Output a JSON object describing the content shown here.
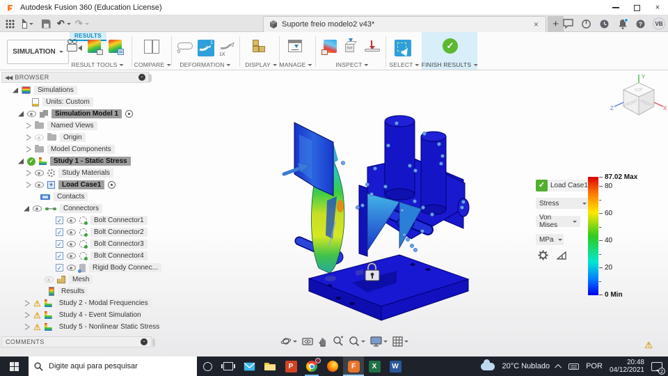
{
  "titlebar": {
    "app_title": "Autodesk Fusion 360 (Education License)"
  },
  "tabbar": {
    "document_title": "Suporte freio modelo2 v43*",
    "avatar_initials": "VB",
    "new_tab": "+",
    "close_tab": "×"
  },
  "ribbon": {
    "workspace_label": "SIMULATION",
    "active_tab": "RESULTS",
    "groups": {
      "result_tools": "RESULT TOOLS",
      "compare": "COMPARE",
      "deformation": "DEFORMATION",
      "display": "DISPLAY",
      "manage": "MANAGE",
      "inspect": "INSPECT",
      "select": "SELECT",
      "finish_results": "FINISH RESULTS"
    },
    "deformation_icon_texts": {
      "off": "0",
      "scale": "1",
      "actual": "1X"
    },
    "inspect_cube_text": "xyz"
  },
  "browser": {
    "panel_title": "BROWSER",
    "items": [
      {
        "label": "Simulations"
      },
      {
        "label": "Units: Custom"
      },
      {
        "label": "Simulation Model 1"
      },
      {
        "label": "Named Views"
      },
      {
        "label": "Origin"
      },
      {
        "label": "Model Components"
      },
      {
        "label": "Study 1 - Static Stress"
      },
      {
        "label": "Study Materials"
      },
      {
        "label": "Load Case1"
      },
      {
        "label": "Contacts"
      },
      {
        "label": "Connectors"
      },
      {
        "label": "Bolt Connector1"
      },
      {
        "label": "Bolt Connector2"
      },
      {
        "label": "Bolt Connector3"
      },
      {
        "label": "Bolt Connector4"
      },
      {
        "label": "Rigid Body Connec..."
      },
      {
        "label": "Mesh"
      },
      {
        "label": "Results"
      },
      {
        "label": "Study 2 - Modal Frequencies"
      },
      {
        "label": "Study 4 - Event Simulation"
      },
      {
        "label": "Study 5 - Nonlinear Static Stress"
      }
    ]
  },
  "legend": {
    "load_case": "Load Case1",
    "result_type": "Stress",
    "component": "Von Mises",
    "unit": "MPa",
    "scale": {
      "max_label": "87.02 Max",
      "ticks": [
        "80",
        "60",
        "40",
        "20"
      ],
      "min_label": "0 Min"
    }
  },
  "viewcube": {
    "top": "TOP",
    "front": "FRONT",
    "right": "RIGHT",
    "axis_x": "X",
    "axis_y": "Y",
    "axis_z": "Z"
  },
  "comments": {
    "panel_title": "COMMENTS"
  },
  "taskbar": {
    "search_placeholder": "Digite aqui para pesquisar",
    "weather": "20°C Nublado",
    "language": "POR",
    "time": "20:48",
    "date": "04/12/2021",
    "notification_count": "2",
    "app_letters": {
      "powerpoint": "P",
      "fusion": "F",
      "excel": "X",
      "word": "W"
    }
  },
  "colors": {
    "accent_blue": "#0696d7",
    "finish_green": "#5cb832",
    "highlight_blue_bg": "#d8eef9",
    "taskbar_bg": "#1d222b"
  }
}
